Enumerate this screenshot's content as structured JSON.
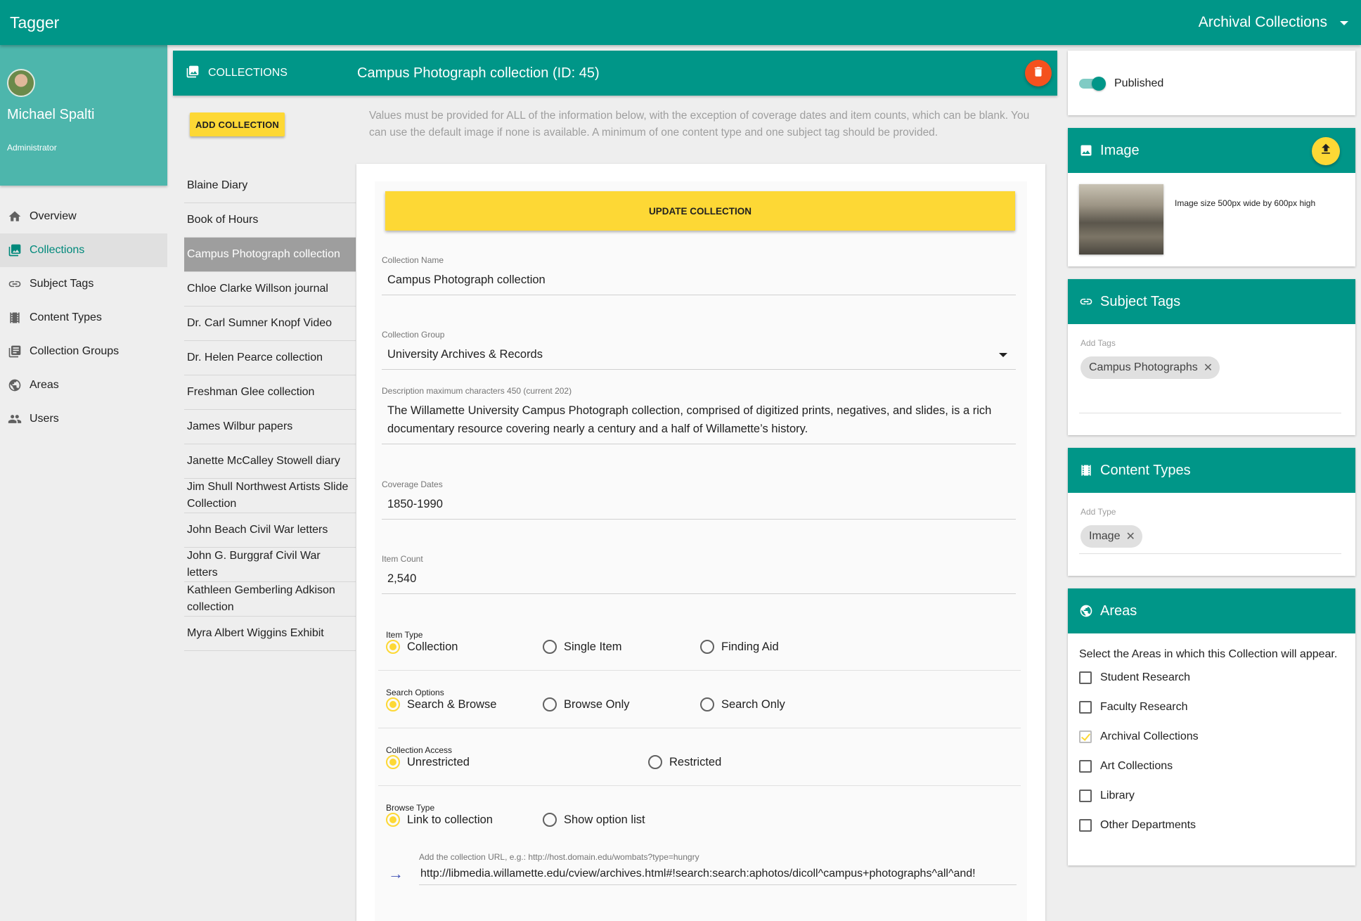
{
  "app": {
    "title": "Tagger",
    "area_selector": "Archival Collections"
  },
  "user": {
    "name": "Michael Spalti",
    "role": "Administrator"
  },
  "nav": [
    {
      "label": "Overview",
      "icon": "home-icon"
    },
    {
      "label": "Collections",
      "icon": "collections-icon",
      "active": true
    },
    {
      "label": "Subject Tags",
      "icon": "link-icon"
    },
    {
      "label": "Content Types",
      "icon": "film-icon"
    },
    {
      "label": "Collection Groups",
      "icon": "library-books-icon"
    },
    {
      "label": "Areas",
      "icon": "globe-icon"
    },
    {
      "label": "Users",
      "icon": "people-icon"
    }
  ],
  "header": {
    "collections_label": "COLLECTIONS",
    "collection_title": "Campus Photograph collection (ID: 45)"
  },
  "add_collection_label": "ADD COLLECTION",
  "help_text": "Values must be provided for ALL of the information below, with the exception of coverage dates and item counts, which can be blank. You can use the default image if none is available. A minimum of one content type and one subject tag should be provided.",
  "collections": [
    "Blaine Diary",
    "Book of Hours",
    "Campus Photograph collection",
    "Chloe Clarke Willson journal",
    "Dr. Carl Sumner Knopf Video",
    "Dr. Helen Pearce collection",
    "Freshman Glee collection",
    "James Wilbur papers",
    "Janette McCalley Stowell diary",
    "Jim Shull Northwest Artists Slide Collection",
    "John Beach Civil War letters",
    "John G. Burggraf Civil War letters",
    "Kathleen Gemberling Adkison collection",
    "Myra Albert Wiggins Exhibit"
  ],
  "form": {
    "update_label": "UPDATE COLLECTION",
    "name_label": "Collection Name",
    "name_value": "Campus Photograph collection",
    "group_label": "Collection Group",
    "group_value": "University Archives & Records",
    "desc_label": "Description  maximum characters 450 (current 202)",
    "desc_value": "The Willamette University Campus Photograph collection, comprised of digitized prints, negatives, and slides, is a rich documentary resource covering nearly a century and a half of Willamette’s history.",
    "dates_label": "Coverage Dates",
    "dates_value": "1850-1990",
    "count_label": "Item Count",
    "count_value": "2,540",
    "item_type": {
      "label": "Item Type",
      "options": [
        "Collection",
        "Single Item",
        "Finding Aid"
      ],
      "selected": 0
    },
    "search_options": {
      "label": "Search Options",
      "options": [
        "Search & Browse",
        "Browse Only",
        "Search Only"
      ],
      "selected": 0
    },
    "access": {
      "label": "Collection Access",
      "options": [
        "Unrestricted",
        "Restricted"
      ],
      "selected": 0
    },
    "browse_type": {
      "label": "Browse Type",
      "options": [
        "Link to collection",
        "Show option list"
      ],
      "selected": 0
    },
    "url_label": "Add the collection URL, e.g.: http://host.domain.edu/wombats?type=hungry",
    "url_value": "http://libmedia.willamette.edu/cview/archives.html#!search:search:aphotos/dicoll^campus+photographs^all^and!"
  },
  "right": {
    "published_label": "Published",
    "image_title": "Image",
    "image_size_text": "Image size 500px wide by 600px high",
    "subject_tags_title": "Subject Tags",
    "add_tags_label": "Add Tags",
    "tags": [
      "Campus Photographs"
    ],
    "content_types_title": "Content Types",
    "add_type_label": "Add Type",
    "types": [
      "Image"
    ],
    "areas_title": "Areas",
    "areas_help": "Select the Areas in which this Collection will appear.",
    "areas": [
      {
        "label": "Student Research",
        "checked": false
      },
      {
        "label": "Faculty Research",
        "checked": false
      },
      {
        "label": "Archival Collections",
        "checked": true
      },
      {
        "label": "Art Collections",
        "checked": false
      },
      {
        "label": "Library",
        "checked": false
      },
      {
        "label": "Other Departments",
        "checked": false
      }
    ]
  },
  "colors": {
    "primary": "#009688",
    "primary_light": "#4db6ac",
    "accent": "#fdd835",
    "danger": "#f4511e"
  }
}
